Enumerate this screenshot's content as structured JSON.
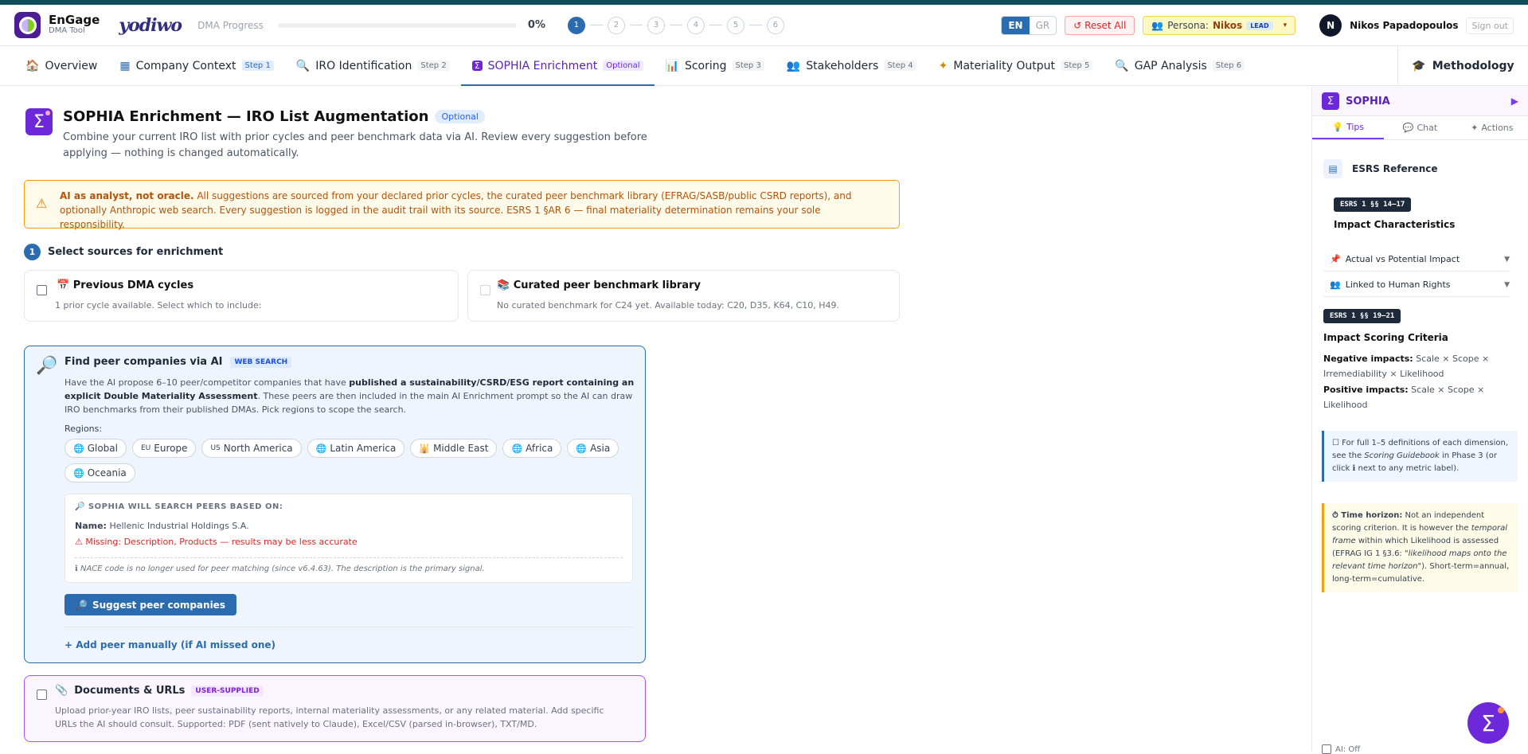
{
  "header": {
    "brand": "EnGage",
    "brand_sub": "DMA Tool",
    "partner_logo": "yodiwo",
    "progress_label": "DMA Progress",
    "progress_pct": "0%",
    "progress_value": 0,
    "steps": [
      "1",
      "2",
      "3",
      "4",
      "5",
      "6"
    ],
    "lang_en": "EN",
    "lang_gr": "GR",
    "reset": "↺ Reset All",
    "persona_label": "Persona:",
    "persona_name": "Nikos",
    "persona_role": "LEAD",
    "user_initial": "N",
    "user_name": "Nikos Papadopoulos",
    "signout": "Sign out"
  },
  "nav": {
    "tabs": [
      {
        "label": "Overview",
        "step": "",
        "icon": "🏠"
      },
      {
        "label": "Company Context",
        "step": "Step 1",
        "icon": "▦"
      },
      {
        "label": "IRO Identification",
        "step": "Step 2",
        "icon": "🔍"
      },
      {
        "label": "SOPHIA Enrichment",
        "step": "Optional",
        "icon": "Σ"
      },
      {
        "label": "Scoring",
        "step": "Step 3",
        "icon": "📊"
      },
      {
        "label": "Stakeholders",
        "step": "Step 4",
        "icon": "👥"
      },
      {
        "label": "Materiality Output",
        "step": "Step 5",
        "icon": "✦"
      },
      {
        "label": "GAP Analysis",
        "step": "Step 6",
        "icon": "🔍"
      }
    ],
    "methodology": "Methodology"
  },
  "page": {
    "title": "SOPHIA Enrichment — IRO List Augmentation",
    "badge": "Optional",
    "subtitle": "Combine your current IRO list with prior cycles and peer benchmark data via AI. Review every suggestion before applying — nothing is changed automatically.",
    "warning_bold": "AI as analyst, not oracle.",
    "warning_text": " All suggestions are sourced from your declared prior cycles, the curated peer benchmark library (EFRAG/SASB/public CSRD reports), and optionally Anthropic web search. Every suggestion is logged in the audit trail with its source. ESRS 1 §AR 6 — final materiality determination remains your sole responsibility.",
    "section_num": "1",
    "section_title": "Select sources for enrichment"
  },
  "sources": {
    "prev_title": "Previous DMA cycles",
    "prev_desc": "1 prior cycle available. Select which to include:",
    "bench_title": "Curated peer benchmark library",
    "bench_desc": "No curated benchmark for C24 yet. Available today: C20, D35, K64, C10, H49."
  },
  "peer": {
    "title": "Find peer companies via AI",
    "tag": "WEB SEARCH",
    "desc_a": "Have the AI propose 6–10 peer/competitor companies that have ",
    "desc_b": "published a sustainability/CSRD/ESG report containing an explicit Double Materiality Assessment",
    "desc_c": ". These peers are then included in the main AI Enrichment prompt so the AI can draw IRO benchmarks from their published DMAs. Pick regions to scope the search.",
    "regions_label": "Regions:",
    "regions": [
      {
        "icon": "🌐",
        "label": "Global"
      },
      {
        "icon": "EU",
        "label": "Europe"
      },
      {
        "icon": "US",
        "label": "North America"
      },
      {
        "icon": "🌐",
        "label": "Latin America"
      },
      {
        "icon": "🕌",
        "label": "Middle East"
      },
      {
        "icon": "🌐",
        "label": "Africa"
      },
      {
        "icon": "🌐",
        "label": "Asia"
      },
      {
        "icon": "🌐",
        "label": "Oceania"
      }
    ],
    "search_heading": "🔎 SOPHIA WILL SEARCH PEERS BASED ON:",
    "name_label": "Name:",
    "name_value": "Hellenic Industrial Holdings S.A.",
    "missing": "⚠ Missing: Description, Products — results may be less accurate",
    "nace_note": "ℹ NACE code is no longer used for peer matching (since v6.4.63). The description is the primary signal.",
    "suggest_btn": "Suggest peer companies",
    "add_manual": "+ Add peer manually (if AI missed one)"
  },
  "docs": {
    "title": "Documents & URLs",
    "tag": "USER-SUPPLIED",
    "desc": "Upload prior-year IRO lists, peer sustainability reports, internal materiality assessments, or any related material. Add specific URLs the AI should consult. Supported: PDF (sent natively to Claude), Excel/CSV (parsed in-browser), TXT/MD."
  },
  "sidebar": {
    "title": "SOPHIA",
    "tabs": [
      "Tips",
      "Chat",
      "Actions"
    ],
    "ref_title": "ESRS Reference",
    "pill1": "ESRS 1 §§ 14–17",
    "sub1": "Impact Characteristics",
    "acc1": "Actual vs Potential Impact",
    "acc2": "Linked to Human Rights",
    "pill2": "ESRS 1 §§ 19–21",
    "sub2": "Impact Scoring Criteria",
    "neg_label": "Negative impacts:",
    "neg_text": " Scale × Scope × Irremediability × Likelihood",
    "pos_label": "Positive impacts:",
    "pos_text": " Scale × Scope × Likelihood",
    "info1_a": "For full 1–5 definitions of each dimension, see the ",
    "info1_i": "Scoring Guidebook",
    "info1_b": " in Phase 3 (or click ℹ next to any metric label).",
    "info2_label": "⏱ Time horizon:",
    "info2_a": " Not an independent scoring criterion. It is however the ",
    "info2_i": "temporal frame",
    "info2_b": " within which Likelihood is assessed (EFRAG IG 1 §3.6: ",
    "info2_q": "\"likelihood maps onto the relevant time horizon\"",
    "info2_c": "). Short-term=annual, long-term=cumulative.",
    "ai_off": "AI: Off"
  },
  "colors": {
    "primary": "#2b6cb0",
    "sophia": "#6d28d9",
    "warning": "#f59e0b"
  }
}
